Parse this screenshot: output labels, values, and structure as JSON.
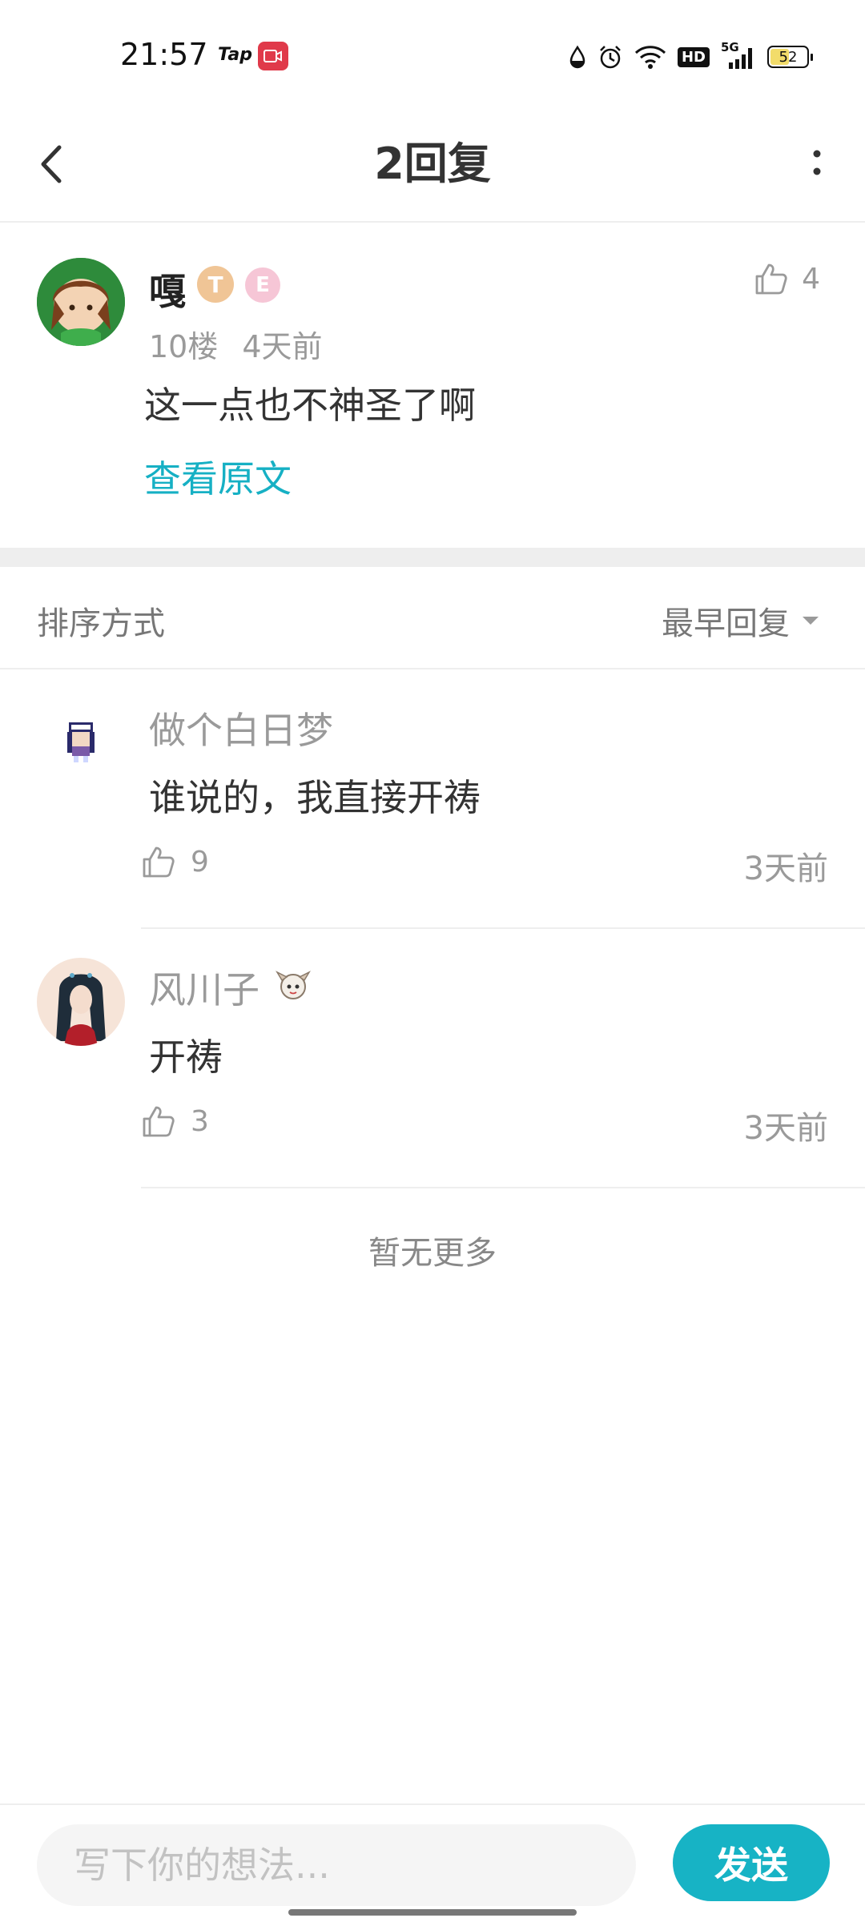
{
  "status_bar": {
    "time": "21:57",
    "tap_label": "Tap",
    "hd_label": "HD",
    "network_label": "5G",
    "battery_level": "52",
    "battery_fraction": 0.52
  },
  "header": {
    "title": "2回复"
  },
  "original_comment": {
    "author": "嘎",
    "badge_t": "T",
    "badge_e": "E",
    "floor": "10楼",
    "time": "4天前",
    "text": "这一点也不神圣了啊",
    "view_original_label": "查看原文",
    "like_count": "4"
  },
  "sort": {
    "label": "排序方式",
    "selected": "最早回复"
  },
  "replies": [
    {
      "author": "做个白日梦",
      "text": "谁说的，我直接开祷",
      "like_count": "9",
      "time": "3天前"
    },
    {
      "author": "风川子",
      "text": "开祷",
      "like_count": "3",
      "time": "3天前"
    }
  ],
  "footer_note": "暂无更多",
  "composer": {
    "placeholder": "写下你的想法...",
    "send_label": "发送"
  },
  "colors": {
    "accent": "#17b3c5",
    "muted_text": "#9a9a9a",
    "divider": "#eeeeee"
  }
}
